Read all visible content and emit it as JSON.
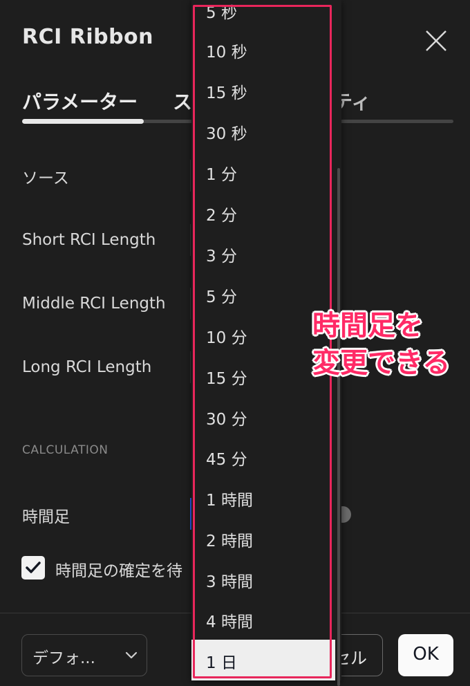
{
  "dialog": {
    "title": "RCI Ribbon",
    "tabs": [
      "パラメーター",
      "ス",
      "ティ"
    ],
    "fields": {
      "source_label": "ソース",
      "short_label": "Short RCI Length",
      "middle_label": "Middle RCI Length",
      "long_label": "Long RCI Length"
    },
    "section_title": "CALCULATION",
    "timeframe_label": "時間足",
    "checkbox_label": "時間足の確定を待"
  },
  "footer": {
    "defaults_label": "デフォ...",
    "cancel_label": "セル",
    "ok_label": "OK"
  },
  "dropdown": {
    "options": [
      "5 秒",
      "10 秒",
      "15 秒",
      "30 秒",
      "1 分",
      "2 分",
      "3 分",
      "5 分",
      "10 分",
      "15 分",
      "30 分",
      "45 分",
      "1 時間",
      "2 時間",
      "3 時間",
      "4 時間",
      "1 日"
    ],
    "selected": "1 日"
  },
  "annotation": {
    "line1": "時間足を",
    "line2": "変更できる",
    "color": "#ff2a66"
  },
  "colors": {
    "background": "#1e1e1e",
    "accent": "#2962ff",
    "highlight": "#e8265b"
  }
}
